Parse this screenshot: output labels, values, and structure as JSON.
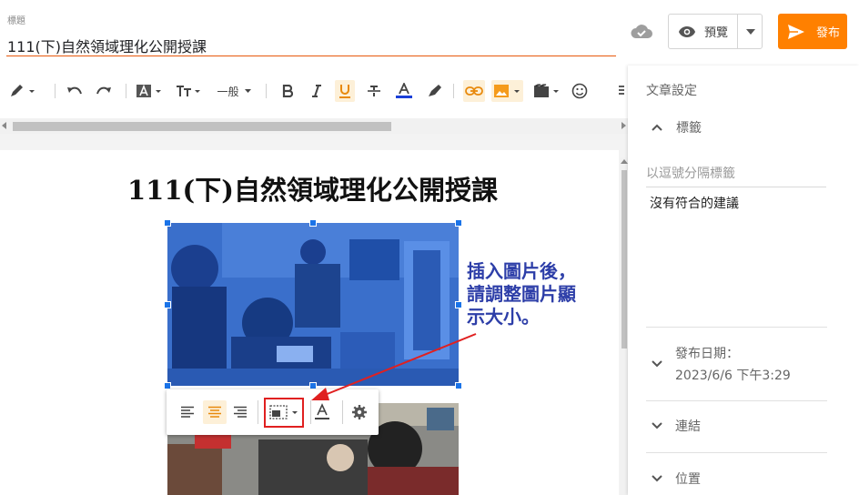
{
  "header": {
    "title_label": "標題",
    "title_value": "111(下)自然領域理化公開授課",
    "preview_label": "預覽",
    "publish_label": "發布"
  },
  "toolbar": {
    "font_size_label": "一般"
  },
  "document": {
    "heading": "111(下)自然領域理化公開授課"
  },
  "annotation": {
    "lines": [
      "插入圖片後，",
      "請調整圖片顯",
      "示大小。"
    ],
    "color": "#2d3ea8",
    "arrow_color": "#e02020"
  },
  "side_panel": {
    "title": "文章設定",
    "labels_section": "標籤",
    "labels_placeholder": "以逗號分隔標籤",
    "no_match": "沒有符合的建議",
    "publish_date_label": "發布日期：",
    "publish_date_value": "2023/6/6 下午3:29",
    "links_label": "連結",
    "location_label": "位置"
  },
  "colors": {
    "accent": "#ff8000",
    "selection_handle": "#1a73e8",
    "title_underline": "#e8590c"
  }
}
